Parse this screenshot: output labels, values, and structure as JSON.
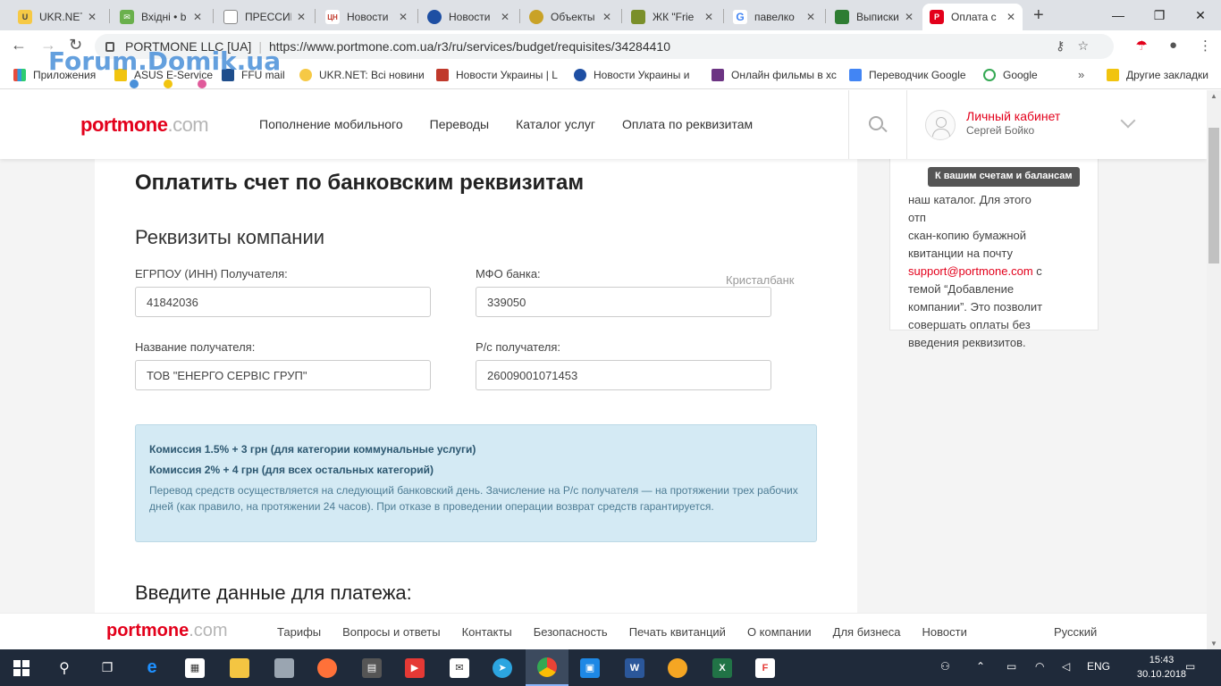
{
  "tabs": [
    {
      "title": "UKR.NET:",
      "color": "#f6c945",
      "glyph": "U"
    },
    {
      "title": "Вхідні • b",
      "color": "#6ab04c",
      "glyph": "✉"
    },
    {
      "title": "ПРЕССИН",
      "color": "#888888",
      "glyph": "▯"
    },
    {
      "title": "Новости",
      "color": "#c0392b",
      "glyph": "ЦН"
    },
    {
      "title": "Новости",
      "color": "#1e4fa3",
      "glyph": "◐"
    },
    {
      "title": "Объекты",
      "color": "#c9a227",
      "glyph": "●"
    },
    {
      "title": "ЖК \"Frie",
      "color": "#7a8f2a",
      "glyph": "▣"
    },
    {
      "title": "павелко",
      "color": "#4285f4",
      "glyph": "G"
    },
    {
      "title": "Выписки",
      "color": "#2e7d32",
      "glyph": "▟"
    },
    {
      "title": "Оплата с",
      "color": "#e3001b",
      "glyph": "P"
    }
  ],
  "browser": {
    "site": "PORTMONE LLC [UA]",
    "url": "https://www.portmone.com.ua/r3/ru/services/budget/requisites/34284410"
  },
  "bookmarks": [
    {
      "label": "Приложения",
      "color": "#e74c3c"
    },
    {
      "label": "ASUS E-Service",
      "color": "#f1c40f"
    },
    {
      "label": "FFU mail",
      "color": "#1f4e8c"
    },
    {
      "label": "UKR.NET: Всі новини",
      "color": "#f6c945"
    },
    {
      "label": "Новости Украины | L",
      "color": "#c0392b"
    },
    {
      "label": "Новости Украины и",
      "color": "#1e4fa3"
    },
    {
      "label": "Онлайн фильмы в хс",
      "color": "#6c3483"
    },
    {
      "label": "Переводчик Google",
      "color": "#4285f4"
    },
    {
      "label": "Google",
      "color": "#34a853"
    },
    {
      "label": "Другие закладки",
      "color": "#f1c40f"
    }
  ],
  "watermark": "Forum.Domik.ua",
  "header": {
    "logo_brand": "portmone",
    "logo_domain": ".com",
    "nav": [
      "Пополнение мобильного",
      "Переводы",
      "Каталог услуг",
      "Оплата по реквизитам"
    ],
    "cabinet_title": "Личный кабинет",
    "cabinet_user": "Сергей Бойко"
  },
  "tooltip": "К вашим счетам и балансам",
  "sidebar": {
    "line1": "наш каталог. Для этого",
    "line2": "отп",
    "line3": "скан-копию бумажной",
    "line4": "квитанции на почту",
    "email": "support@portmone.com",
    "after_email": " с",
    "line6": "темой “Добавление",
    "line7": "компании”. Это позволит",
    "line8": "совершать оплаты без",
    "line9": "введения реквизитов."
  },
  "main": {
    "title": "Оплатить счет по банковским реквизитам",
    "section": "Реквизиты компании",
    "edrpou_label": "ЕГРПОУ (ИНН) Получателя:",
    "edrpou_value": "41842036",
    "mfo_label": "МФО банка:",
    "mfo_value": "339050",
    "bank_name": "Кристалбанк",
    "recipient_label": "Название получателя:",
    "recipient_value": "ТОВ \"ЕНЕРГО СЕРВІС ГРУП\"",
    "account_label": "Р/с получателя:",
    "account_value": "26009001071453",
    "commission1": "Комиссия 1.5% + 3 грн (для категории коммунальные услуги)",
    "commission2": "Комиссия 2% + 4 грн (для всех остальных категорий)",
    "note": "Перевод средств осуществляется на следующий банковский день. Зачисление на Р/с получателя — на протяжении трех рабочих дней (как правило, на протяжении 24 часов). При отказе в проведении операции возврат средств гарантируется.",
    "payment_title": "Введите данные для платежа:"
  },
  "footer": {
    "logo_brand": "portmone",
    "logo_domain": ".com",
    "links": [
      "Тарифы",
      "Вопросы и ответы",
      "Контакты",
      "Безопасность",
      "Печать квитанций",
      "О компании",
      "Для бизнеса",
      "Новости"
    ],
    "language": "Русский"
  },
  "taskbar": {
    "language": "ENG",
    "time": "15:43",
    "date": "30.10.2018"
  }
}
